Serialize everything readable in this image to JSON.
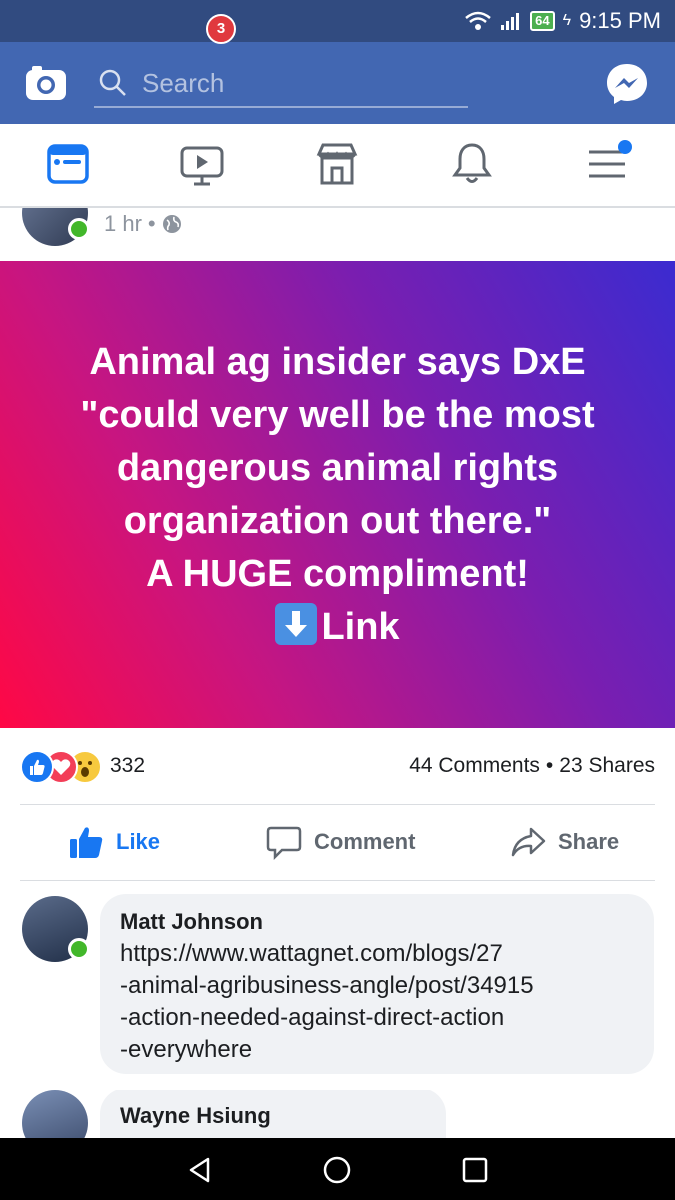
{
  "status_bar": {
    "battery": "64",
    "time": "9:15 PM"
  },
  "app_bar": {
    "search_placeholder": "Search"
  },
  "tabs": {
    "video_badge": "3"
  },
  "post": {
    "time": "1 hr",
    "separator": "•",
    "banner_lines": [
      "Animal ag insider says DxE",
      "\"could very well be the most",
      "dangerous animal rights",
      "organization out there.\"",
      "A HUGE compliment!"
    ],
    "banner_link": "Link",
    "reaction_count": "332",
    "comments": "44 Comments",
    "dot": "•",
    "shares": "23 Shares",
    "actions": {
      "like": "Like",
      "comment": "Comment",
      "share": "Share"
    }
  },
  "comments": [
    {
      "name": "Matt Johnson",
      "lines": [
        "https://www.wattagnet.com/blogs/27",
        "-animal-agribusiness-angle/post/34915",
        "-action-needed-against-direct-action",
        "-everywhere"
      ]
    },
    {
      "name": "Wayne Hsiung"
    }
  ],
  "colors": {
    "status_bar": "#314b80",
    "app_bar": "#4267b2",
    "accent": "#1877f2",
    "badge": "#e0393e",
    "online": "#42b72a"
  },
  "icons": [
    "camera-icon",
    "search-icon",
    "messenger-icon",
    "news-feed-icon",
    "watch-icon",
    "marketplace-icon",
    "notifications-icon",
    "menu-icon",
    "globe-icon",
    "like-icon",
    "comment-icon",
    "share-icon",
    "back-icon",
    "home-icon",
    "recents-icon"
  ]
}
